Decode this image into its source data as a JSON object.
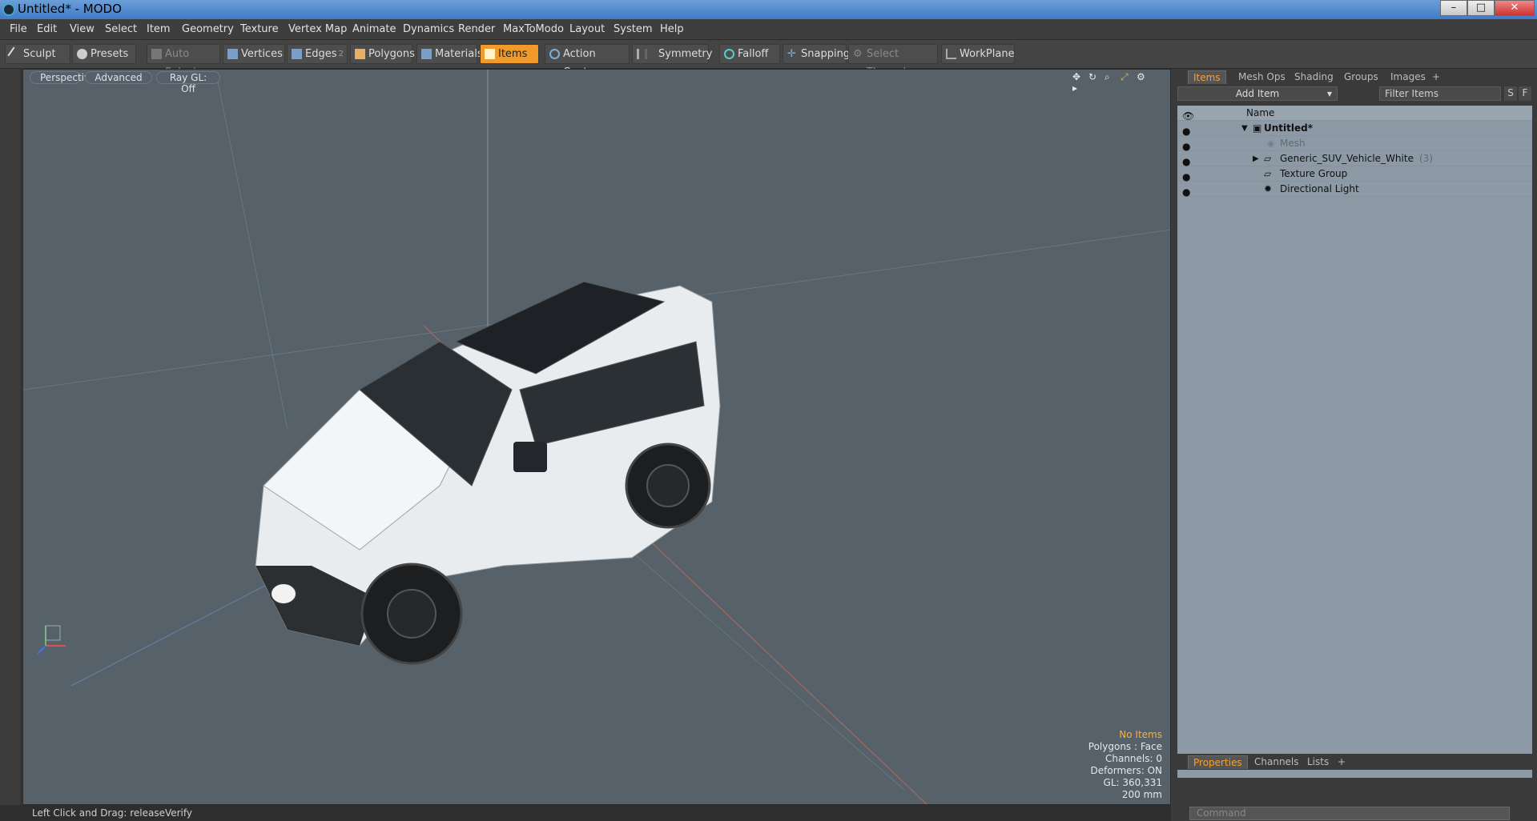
{
  "window": {
    "title": "Untitled* - MODO"
  },
  "menu": [
    "File",
    "Edit",
    "View",
    "Select",
    "Item",
    "Geometry",
    "Texture",
    "Vertex Map",
    "Animate",
    "Dynamics",
    "Render",
    "MaxToModo",
    "Layout",
    "System",
    "Help"
  ],
  "toolbar": {
    "sculpt": "Sculpt",
    "presets": "Presets",
    "auto_select": "Auto Select",
    "vertices": "Vertices",
    "edges": "Edges",
    "edges_count": "2",
    "polygons": "Polygons",
    "materials": "Materials",
    "items": "Items",
    "action_center": "Action Center",
    "symmetry": "Symmetry",
    "falloff": "Falloff",
    "snapping": "Snapping",
    "select_through": "Select Through",
    "workplane": "WorkPlane"
  },
  "viewport": {
    "view": "Perspective",
    "shading": "Advanced",
    "raygl": "Ray GL: Off",
    "info": {
      "selection": "No Items",
      "polygons": "Polygons : Face",
      "channels": "Channels: 0",
      "deformers": "Deformers: ON",
      "gl": "GL: 360,331",
      "scale": "200 mm"
    }
  },
  "status": "Left Click and Drag:  releaseVerify",
  "panel": {
    "tabs": [
      "Items",
      "Mesh Ops",
      "Shading",
      "Groups",
      "Images"
    ],
    "add_item": "Add Item",
    "filter_placeholder": "Filter Items",
    "col_name": "Name",
    "items": [
      {
        "name": "Untitled*"
      },
      {
        "name": "Mesh"
      },
      {
        "name": "Generic_SUV_Vehicle_White",
        "count": "(3)"
      },
      {
        "name": "Texture Group"
      },
      {
        "name": "Directional Light"
      }
    ],
    "bottom_tabs": [
      "Properties",
      "Channels",
      "Lists"
    ],
    "command_placeholder": "Command"
  },
  "colors": {
    "accent": "#f09a2a",
    "viewport_bg": "#566169",
    "list_bg": "#8d9aa5"
  }
}
